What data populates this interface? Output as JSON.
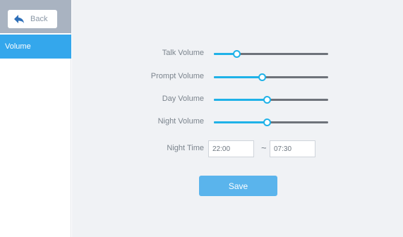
{
  "sidebar": {
    "back_label": "Back",
    "items": [
      {
        "label": "Volume",
        "active": true
      }
    ]
  },
  "volume": {
    "sliders": [
      {
        "label": "Talk Volume",
        "level_percent": 20
      },
      {
        "label": "Prompt Volume",
        "level_percent": 42
      },
      {
        "label": "Day Volume",
        "level_percent": 46
      },
      {
        "label": "Night Volume",
        "level_percent": 46
      }
    ],
    "night_time": {
      "label": "Night Time",
      "start": "22:00",
      "separator": "~",
      "end": "07:30"
    },
    "save_label": "Save"
  },
  "colors": {
    "accent": "#34a7ec",
    "slider_fill": "#1fb2e8",
    "slider_track": "#6e737a",
    "sidebar_top": "#a9b3c1",
    "main_bg": "#f0f2f5"
  }
}
